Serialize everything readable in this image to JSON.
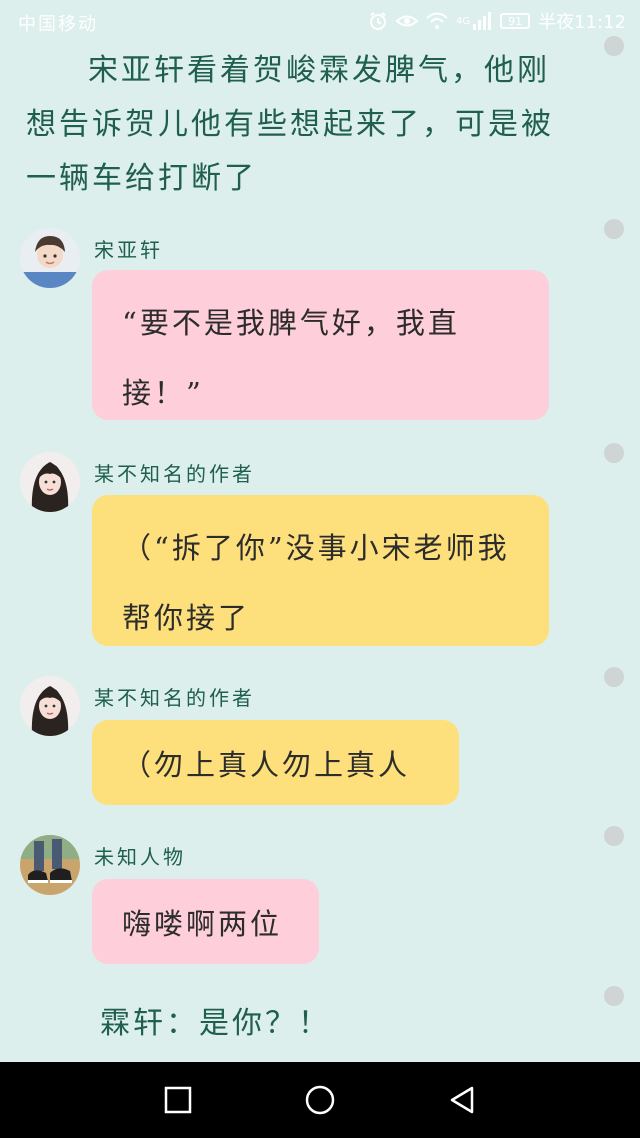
{
  "status_bar": {
    "carrier": "中国移动",
    "signal_label": "4G",
    "battery_level": "91",
    "time": "半夜11:12",
    "icons": [
      "alarm-icon",
      "eye-comfort-icon",
      "wifi-icon",
      "signal-icon",
      "battery-icon"
    ]
  },
  "narration": "宋亚轩看着贺峻霖发脾气，他刚想告诉贺儿他有些想起来了，可是被一辆车给打断了",
  "messages": [
    {
      "sender": "宋亚轩",
      "avatar": "avatar-boy-icon",
      "text": "“要不是我脾气好，我直接！”",
      "bubble_color": "#fecfda"
    },
    {
      "sender": "某不知名的作者",
      "avatar": "avatar-girl-icon",
      "text": "（“拆了你”没事小宋老师我帮你接了",
      "bubble_color": "#fde07c"
    },
    {
      "sender": "某不知名的作者",
      "avatar": "avatar-girl-icon",
      "text": "（勿上真人勿上真人",
      "bubble_color": "#fde07c"
    },
    {
      "sender": "未知人物",
      "avatar": "avatar-shoes-icon",
      "text": "嗨喽啊两位",
      "bubble_color": "#fecfda"
    }
  ],
  "closing_line": "霖轩：是你？！",
  "nav_bar": {
    "buttons": [
      "recents-square-icon",
      "home-circle-icon",
      "back-triangle-icon"
    ]
  },
  "colors": {
    "background": "#dcefed",
    "narration_text": "#1f5f4c",
    "pink_bubble": "#fecfda",
    "yellow_bubble": "#fde07c"
  }
}
